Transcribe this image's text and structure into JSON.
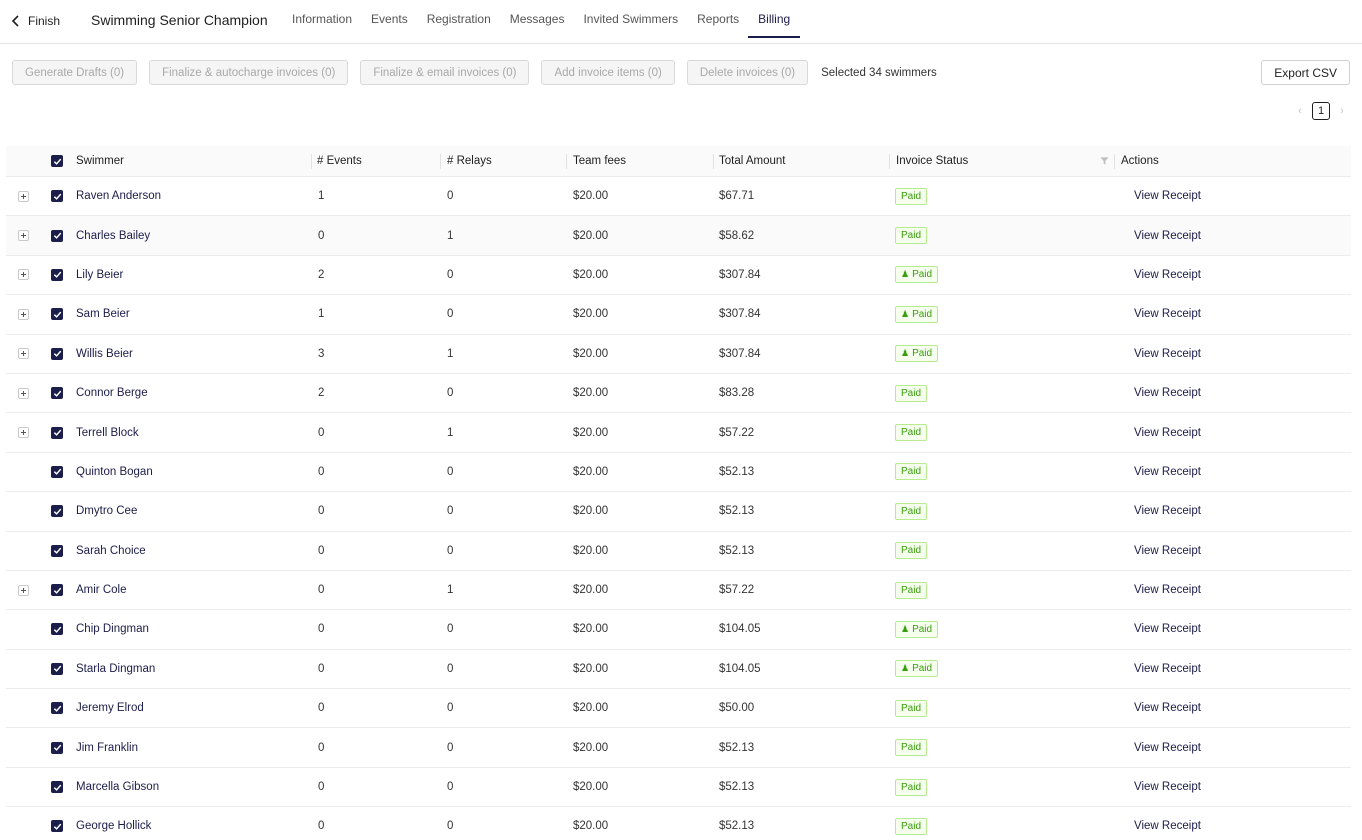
{
  "header": {
    "back_label": "Finish",
    "title": "Swimming Senior Champion",
    "tabs": [
      {
        "label": "Information",
        "active": false
      },
      {
        "label": "Events",
        "active": false
      },
      {
        "label": "Registration",
        "active": false
      },
      {
        "label": "Messages",
        "active": false
      },
      {
        "label": "Invited Swimmers",
        "active": false
      },
      {
        "label": "Reports",
        "active": false
      },
      {
        "label": "Billing",
        "active": true
      }
    ]
  },
  "toolbar": {
    "generate_drafts": "Generate Drafts (0)",
    "finalize_autocharge": "Finalize & autocharge invoices (0)",
    "finalize_email": "Finalize & email invoices (0)",
    "add_items": "Add invoice items (0)",
    "delete_invoices": "Delete invoices (0)",
    "selected_text": "Selected 34 swimmers",
    "export_csv": "Export CSV"
  },
  "pagination": {
    "current_page": "1",
    "prev_icon": "chevron-left-icon",
    "next_icon": "chevron-right-icon"
  },
  "table": {
    "columns": {
      "swimmer": "Swimmer",
      "events": "# Events",
      "relays": "# Relays",
      "team_fees": "Team fees",
      "total": "Total Amount",
      "status": "Invoice Status",
      "actions": "Actions"
    },
    "rows": [
      {
        "expandable": true,
        "name": "Raven Anderson",
        "events": "1",
        "relays": "0",
        "fees": "$20.00",
        "total": "$67.71",
        "status": "Paid",
        "family": false,
        "action": "View Receipt"
      },
      {
        "expandable": true,
        "name": "Charles Bailey",
        "events": "0",
        "relays": "1",
        "fees": "$20.00",
        "total": "$58.62",
        "status": "Paid",
        "family": false,
        "action": "View Receipt"
      },
      {
        "expandable": true,
        "name": "Lily Beier",
        "events": "2",
        "relays": "0",
        "fees": "$20.00",
        "total": "$307.84",
        "status": "Paid",
        "family": true,
        "action": "View Receipt"
      },
      {
        "expandable": true,
        "name": "Sam Beier",
        "events": "1",
        "relays": "0",
        "fees": "$20.00",
        "total": "$307.84",
        "status": "Paid",
        "family": true,
        "action": "View Receipt"
      },
      {
        "expandable": true,
        "name": "Willis Beier",
        "events": "3",
        "relays": "1",
        "fees": "$20.00",
        "total": "$307.84",
        "status": "Paid",
        "family": true,
        "action": "View Receipt"
      },
      {
        "expandable": true,
        "name": "Connor Berge",
        "events": "2",
        "relays": "0",
        "fees": "$20.00",
        "total": "$83.28",
        "status": "Paid",
        "family": false,
        "action": "View Receipt"
      },
      {
        "expandable": true,
        "name": "Terrell Block",
        "events": "0",
        "relays": "1",
        "fees": "$20.00",
        "total": "$57.22",
        "status": "Paid",
        "family": false,
        "action": "View Receipt"
      },
      {
        "expandable": false,
        "name": "Quinton Bogan",
        "events": "0",
        "relays": "0",
        "fees": "$20.00",
        "total": "$52.13",
        "status": "Paid",
        "family": false,
        "action": "View Receipt"
      },
      {
        "expandable": false,
        "name": "Dmytro Cee",
        "events": "0",
        "relays": "0",
        "fees": "$20.00",
        "total": "$52.13",
        "status": "Paid",
        "family": false,
        "action": "View Receipt"
      },
      {
        "expandable": false,
        "name": "Sarah Choice",
        "events": "0",
        "relays": "0",
        "fees": "$20.00",
        "total": "$52.13",
        "status": "Paid",
        "family": false,
        "action": "View Receipt"
      },
      {
        "expandable": true,
        "name": "Amir Cole",
        "events": "0",
        "relays": "1",
        "fees": "$20.00",
        "total": "$57.22",
        "status": "Paid",
        "family": false,
        "action": "View Receipt"
      },
      {
        "expandable": false,
        "name": "Chip Dingman",
        "events": "0",
        "relays": "0",
        "fees": "$20.00",
        "total": "$104.05",
        "status": "Paid",
        "family": true,
        "action": "View Receipt"
      },
      {
        "expandable": false,
        "name": "Starla Dingman",
        "events": "0",
        "relays": "0",
        "fees": "$20.00",
        "total": "$104.05",
        "status": "Paid",
        "family": true,
        "action": "View Receipt"
      },
      {
        "expandable": false,
        "name": "Jeremy Elrod",
        "events": "0",
        "relays": "0",
        "fees": "$20.00",
        "total": "$50.00",
        "status": "Paid",
        "family": false,
        "action": "View Receipt"
      },
      {
        "expandable": false,
        "name": "Jim Franklin",
        "events": "0",
        "relays": "0",
        "fees": "$20.00",
        "total": "$52.13",
        "status": "Paid",
        "family": false,
        "action": "View Receipt"
      },
      {
        "expandable": false,
        "name": "Marcella Gibson",
        "events": "0",
        "relays": "0",
        "fees": "$20.00",
        "total": "$52.13",
        "status": "Paid",
        "family": false,
        "action": "View Receipt"
      },
      {
        "expandable": false,
        "name": "George Hollick",
        "events": "0",
        "relays": "0",
        "fees": "$20.00",
        "total": "$52.13",
        "status": "Paid",
        "family": false,
        "action": "View Receipt"
      }
    ]
  },
  "colors": {
    "accent": "#1b1d4a",
    "paid_text": "#389e0d",
    "paid_bg": "#f6ffed",
    "paid_border": "#b7eb8f"
  }
}
